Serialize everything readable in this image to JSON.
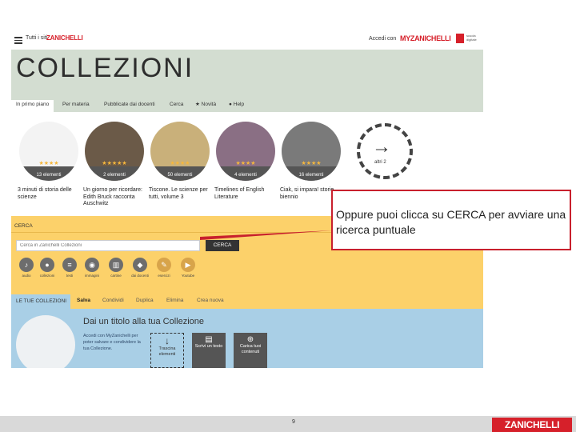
{
  "topbar": {
    "tutti_label": "Tutti i siti",
    "brand": "ZANICHELLI",
    "accedi_label": "Accedi con",
    "myz_label": "MYZANICHELLI",
    "scuola_label": "scuola digitale"
  },
  "header": {
    "title": "COLLEZIONI"
  },
  "tabs": [
    {
      "label": "In primo piano"
    },
    {
      "label": "Per materia"
    },
    {
      "label": "Pubblicate dai docenti"
    },
    {
      "label": "Cerca"
    },
    {
      "label": "Novità"
    },
    {
      "label": "Help"
    }
  ],
  "carousel": {
    "items": [
      {
        "count": "13 elementi",
        "stars": "★★★★",
        "caption": "3 minuti di storia delle scienze"
      },
      {
        "count": "2 elementi",
        "stars": "★★★★★",
        "caption": "Un giorno per ricordare: Edith Bruck racconta Auschwitz"
      },
      {
        "count": "50 elementi",
        "stars": "★★★★",
        "caption": "Tiscone. Le scienze per tutti, volume 3"
      },
      {
        "count": "4 elementi",
        "stars": "★★★★",
        "caption": "Timelines of English Literature"
      },
      {
        "count": "16 elementi",
        "stars": "★★★★",
        "caption": "Ciak, si impara! storie biennio"
      }
    ],
    "more_label": "altri 2"
  },
  "search": {
    "tab_label": "CERCA",
    "placeholder": "Cerca in Zanichelli Collezioni",
    "button_label": "CERCA",
    "filters": [
      {
        "label": "audio"
      },
      {
        "label": "collezioni"
      },
      {
        "label": "testi"
      },
      {
        "label": "immagini"
      },
      {
        "label": "cartine"
      },
      {
        "label": "dai docenti"
      },
      {
        "label": "esercizi"
      },
      {
        "label": "Youtube"
      }
    ]
  },
  "collections": {
    "tab_label": "LE TUE COLLEZIONI",
    "actions": [
      "Salva",
      "Condividi",
      "Duplica",
      "Elimina",
      "Crea nuova"
    ],
    "title": "Dai un titolo alla tua Collezione",
    "desc": "Accedi con MyZanichelli per poter salvare e condividere la tua Collezione.",
    "drop_label": "Trascina elementi",
    "write_label": "Scrivi un testo",
    "upload_label": "Carica tuoi contenuti"
  },
  "callout": {
    "text": "Oppure puoi clicca su CERCA per avviare una ricerca puntuale"
  },
  "footer": {
    "page_number": "9",
    "logo": "ZANICHELLI"
  },
  "colors": {
    "header_bg": "#d3ddd1",
    "search_bg": "#fcd16a",
    "collection_bg": "#a9cfe6",
    "brand_red": "#d6202a",
    "callout_border": "#c8202d"
  }
}
